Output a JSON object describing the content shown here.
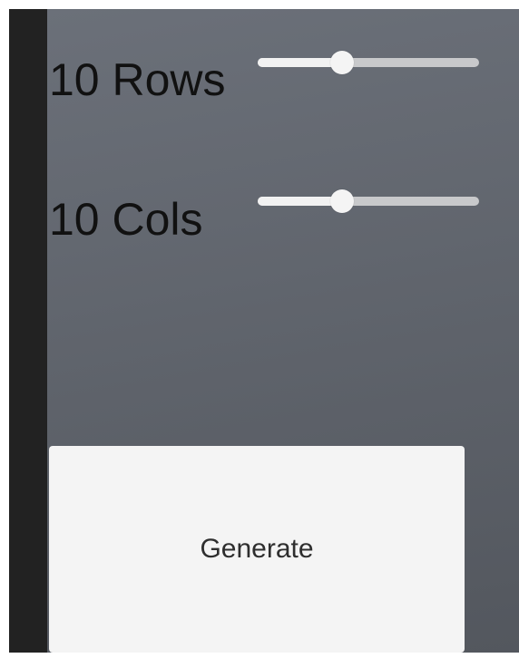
{
  "rows": {
    "label": "10 Rows",
    "slider_level": 0.38
  },
  "cols": {
    "label": "10 Cols",
    "slider_level": 0.38
  },
  "generate_button": {
    "label": "Generate"
  },
  "colors": {
    "panel_top": "#6b7079",
    "panel_bottom": "#53575e",
    "sidebar": "#222222",
    "slider_fill": "#f2f2f2",
    "slider_track": "#c8c9cb",
    "button_bg": "#f4f4f4"
  }
}
